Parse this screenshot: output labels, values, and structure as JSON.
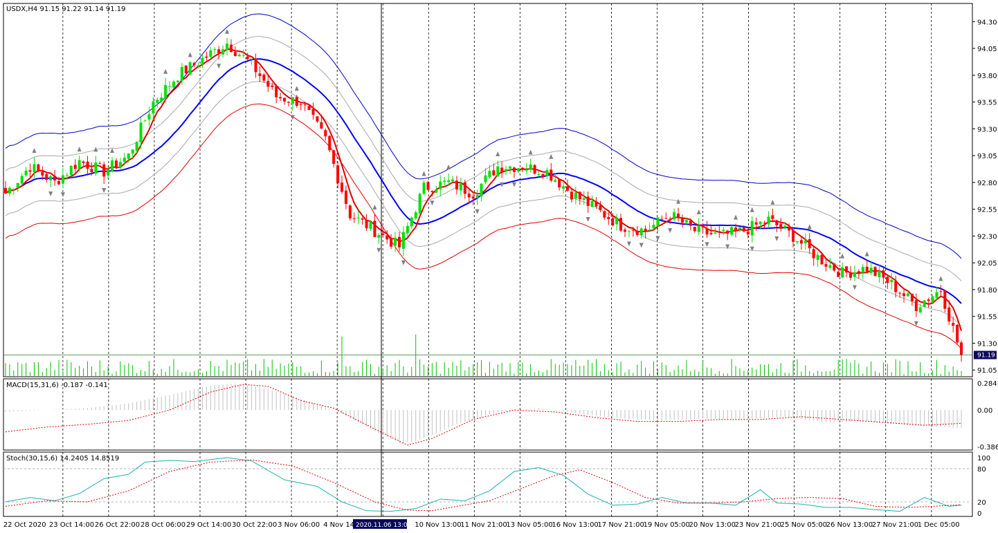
{
  "window": {
    "symbol_header": "USDX,H4  91.15 91.22 91.14 91.19",
    "current_price_label": "91.19"
  },
  "panels": {
    "macd_header": "MACD(15,31,6) -0.187 -0.141",
    "stoch_header": "Stoch(30,15,6) 14.2405 14.8519"
  },
  "crosshair_time_label": "2020.11.06 13:00",
  "colors": {
    "bull": "#00e000",
    "bear": "#ff0000",
    "middle_band": "#0000ff",
    "upper_band": "#0000c8",
    "lower_band": "#e00000",
    "inner_band": "#a8a8a8",
    "fast_ma": "#e00000",
    "volume": "#00c000",
    "macd_hist": "#c0c0c0",
    "macd_signal": "#e00000",
    "stoch_main": "#20b0b0",
    "stoch_signal": "#e00000"
  },
  "chart_data": [
    {
      "type": "candlestick",
      "panel": "price",
      "title": "USDX,H4",
      "ylim": [
        91.0,
        94.45
      ],
      "y_ticks": [
        "94.30",
        "94.05",
        "93.80",
        "93.55",
        "93.30",
        "93.05",
        "92.80",
        "92.55",
        "92.30",
        "92.05",
        "91.80",
        "91.55",
        "91.30",
        "91.05"
      ],
      "x_ticks": [
        "22 Oct 2020",
        "23 Oct 14:00",
        "26 Oct 22:00",
        "28 Oct 06:00",
        "29 Oct 14:00",
        "30 Oct 22:00",
        "3 Nov 06:00",
        "4 Nov 14:00",
        "2020.11.06 13:00",
        "10 Nov 13:00",
        "11 Nov 21:00",
        "13 Nov 05:00",
        "16 Nov 13:00",
        "17 Nov 21:00",
        "19 Nov 05:00",
        "20 Nov 13:00",
        "23 Nov 21:00",
        "25 Nov 05:00",
        "26 Nov 13:00",
        "27 Nov 21:00",
        "1 Dec 05:00"
      ],
      "last_price": 91.19,
      "close_keypoints": [
        [
          0,
          92.7
        ],
        [
          6,
          92.95
        ],
        [
          12,
          92.8
        ],
        [
          18,
          93.0
        ],
        [
          24,
          92.9
        ],
        [
          30,
          93.05
        ],
        [
          36,
          93.55
        ],
        [
          42,
          93.8
        ],
        [
          48,
          93.95
        ],
        [
          54,
          94.1
        ],
        [
          60,
          93.9
        ],
        [
          66,
          93.6
        ],
        [
          72,
          93.55
        ],
        [
          78,
          93.2
        ],
        [
          84,
          92.5
        ],
        [
          90,
          92.35
        ],
        [
          96,
          92.2
        ],
        [
          102,
          92.75
        ],
        [
          108,
          92.8
        ],
        [
          114,
          92.7
        ],
        [
          120,
          92.95
        ],
        [
          126,
          92.95
        ],
        [
          132,
          92.9
        ],
        [
          138,
          92.7
        ],
        [
          144,
          92.55
        ],
        [
          150,
          92.4
        ],
        [
          156,
          92.35
        ],
        [
          162,
          92.5
        ],
        [
          168,
          92.35
        ],
        [
          174,
          92.3
        ],
        [
          180,
          92.35
        ],
        [
          186,
          92.45
        ],
        [
          192,
          92.3
        ],
        [
          198,
          92.1
        ],
        [
          204,
          91.95
        ],
        [
          210,
          92.0
        ],
        [
          216,
          91.85
        ],
        [
          222,
          91.65
        ],
        [
          228,
          91.8
        ],
        [
          233,
          91.19
        ]
      ],
      "count": 234,
      "overlays": [
        "upper band",
        "inner bands",
        "middle band",
        "lower band",
        "fast moving average"
      ],
      "fractal_markers": true,
      "volume": true
    },
    {
      "type": "histogram+line",
      "panel": "MACD",
      "params": "MACD(15,31,6)",
      "values": {
        "main": -0.187,
        "signal": -0.141
      },
      "ylim": [
        -0.4,
        0.3
      ],
      "y_ticks": [
        "0.284",
        "0.00",
        "-0.386"
      ],
      "main_keypoints": [
        [
          0,
          -0.02
        ],
        [
          10,
          0.0
        ],
        [
          20,
          0.02
        ],
        [
          30,
          0.07
        ],
        [
          40,
          0.16
        ],
        [
          50,
          0.26
        ],
        [
          56,
          0.28
        ],
        [
          62,
          0.24
        ],
        [
          70,
          0.15
        ],
        [
          80,
          0.0
        ],
        [
          90,
          -0.22
        ],
        [
          96,
          -0.35
        ],
        [
          100,
          -0.33
        ],
        [
          110,
          -0.15
        ],
        [
          120,
          -0.02
        ],
        [
          130,
          0.02
        ],
        [
          140,
          -0.04
        ],
        [
          150,
          -0.09
        ],
        [
          160,
          -0.11
        ],
        [
          170,
          -0.09
        ],
        [
          180,
          -0.1
        ],
        [
          190,
          -0.07
        ],
        [
          200,
          -0.13
        ],
        [
          210,
          -0.12
        ],
        [
          220,
          -0.16
        ],
        [
          233,
          -0.19
        ]
      ],
      "signal_keypoints": [
        [
          0,
          -0.23
        ],
        [
          10,
          -0.18
        ],
        [
          20,
          -0.15
        ],
        [
          30,
          -0.11
        ],
        [
          40,
          0.0
        ],
        [
          50,
          0.19
        ],
        [
          58,
          0.27
        ],
        [
          64,
          0.25
        ],
        [
          72,
          0.1
        ],
        [
          80,
          0.02
        ],
        [
          90,
          -0.2
        ],
        [
          98,
          -0.37
        ],
        [
          104,
          -0.3
        ],
        [
          114,
          -0.1
        ],
        [
          124,
          0.0
        ],
        [
          134,
          -0.02
        ],
        [
          144,
          -0.08
        ],
        [
          154,
          -0.12
        ],
        [
          164,
          -0.12
        ],
        [
          174,
          -0.1
        ],
        [
          184,
          -0.1
        ],
        [
          194,
          -0.07
        ],
        [
          204,
          -0.1
        ],
        [
          214,
          -0.13
        ],
        [
          224,
          -0.16
        ],
        [
          233,
          -0.14
        ]
      ]
    },
    {
      "type": "line",
      "panel": "Stochastic",
      "params": "Stoch(30,15,6)",
      "values": {
        "main": 14.2405,
        "signal": 14.8519
      },
      "ylim": [
        0,
        100
      ],
      "y_ticks": [
        "100",
        "80",
        "20",
        "0"
      ],
      "levels": [
        80,
        20
      ],
      "main_keypoints": [
        [
          0,
          20
        ],
        [
          6,
          28
        ],
        [
          12,
          22
        ],
        [
          18,
          35
        ],
        [
          24,
          62
        ],
        [
          30,
          70
        ],
        [
          34,
          92
        ],
        [
          40,
          95
        ],
        [
          46,
          93
        ],
        [
          54,
          100
        ],
        [
          60,
          94
        ],
        [
          68,
          60
        ],
        [
          76,
          48
        ],
        [
          82,
          20
        ],
        [
          88,
          4
        ],
        [
          94,
          3
        ],
        [
          100,
          8
        ],
        [
          106,
          25
        ],
        [
          112,
          22
        ],
        [
          118,
          40
        ],
        [
          124,
          75
        ],
        [
          130,
          82
        ],
        [
          136,
          68
        ],
        [
          142,
          34
        ],
        [
          148,
          14
        ],
        [
          154,
          16
        ],
        [
          160,
          28
        ],
        [
          166,
          18
        ],
        [
          172,
          18
        ],
        [
          178,
          14
        ],
        [
          184,
          42
        ],
        [
          188,
          18
        ],
        [
          194,
          16
        ],
        [
          200,
          10
        ],
        [
          206,
          10
        ],
        [
          212,
          6
        ],
        [
          218,
          3
        ],
        [
          224,
          28
        ],
        [
          230,
          12
        ],
        [
          233,
          14
        ]
      ],
      "signal_keypoints": [
        [
          0,
          12
        ],
        [
          10,
          22
        ],
        [
          20,
          20
        ],
        [
          30,
          40
        ],
        [
          40,
          75
        ],
        [
          50,
          92
        ],
        [
          60,
          96
        ],
        [
          70,
          85
        ],
        [
          80,
          55
        ],
        [
          90,
          20
        ],
        [
          98,
          5
        ],
        [
          104,
          4
        ],
        [
          110,
          12
        ],
        [
          118,
          22
        ],
        [
          126,
          45
        ],
        [
          134,
          68
        ],
        [
          140,
          78
        ],
        [
          148,
          55
        ],
        [
          156,
          28
        ],
        [
          164,
          18
        ],
        [
          172,
          18
        ],
        [
          180,
          20
        ],
        [
          188,
          26
        ],
        [
          196,
          28
        ],
        [
          204,
          26
        ],
        [
          212,
          12
        ],
        [
          220,
          10
        ],
        [
          226,
          12
        ],
        [
          233,
          15
        ]
      ]
    }
  ]
}
